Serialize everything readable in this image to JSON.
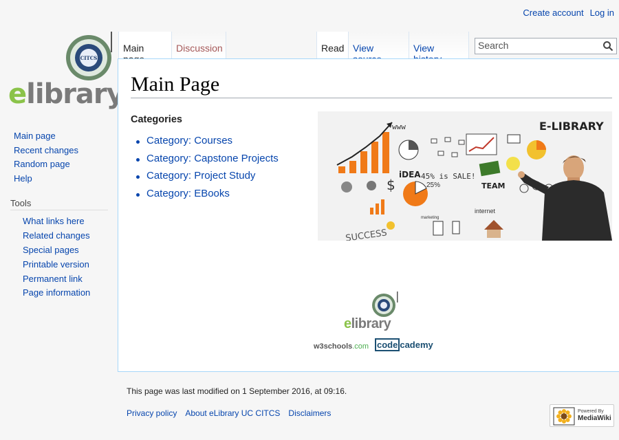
{
  "personal": {
    "create_account": "Create account",
    "log_in": "Log in"
  },
  "logo": {
    "text_e": "e",
    "text_rest": "library"
  },
  "tabs": {
    "main_page": "Main page",
    "discussion": "Discussion",
    "read": "Read",
    "view_source": "View source",
    "view_history": "View history"
  },
  "search": {
    "placeholder": "Search"
  },
  "sidebar": {
    "nav": [
      "Main page",
      "Recent changes",
      "Random page",
      "Help"
    ],
    "tools_heading": "Tools",
    "tools": [
      "What links here",
      "Related changes",
      "Special pages",
      "Printable version",
      "Permanent link",
      "Page information"
    ]
  },
  "content": {
    "title": "Main Page",
    "categories_heading": "Categories",
    "categories": [
      "Category: Courses",
      "Category: Capstone Projects",
      "Category: Project Study",
      "Category: EBooks"
    ],
    "banner": {
      "title": "E-LIBRARY",
      "www": "www",
      "idea": "iDEA",
      "sale": "45% is SALE!",
      "pct": "25%",
      "team": "TEAM",
      "internet": "internet",
      "success": "SUCCESS",
      "marketing": "marketing"
    },
    "footer_logo": {
      "e": "e",
      "library": "library",
      "w3": "w3schools",
      "w3_com": ".com",
      "cc_code": "code",
      "cc_rest": "cademy"
    }
  },
  "footer": {
    "last_modified": "This page was last modified on 1 September 2016, at 09:16.",
    "links": [
      "Privacy policy",
      "About eLibrary UC CITCS",
      "Disclaimers"
    ],
    "powered_by": "Powered By",
    "mediawiki": "MediaWiki"
  },
  "colors": {
    "link": "#0645ad",
    "new_link": "#a55858",
    "accent_green": "#8bc34a",
    "border_blue": "#a7d7f9"
  }
}
